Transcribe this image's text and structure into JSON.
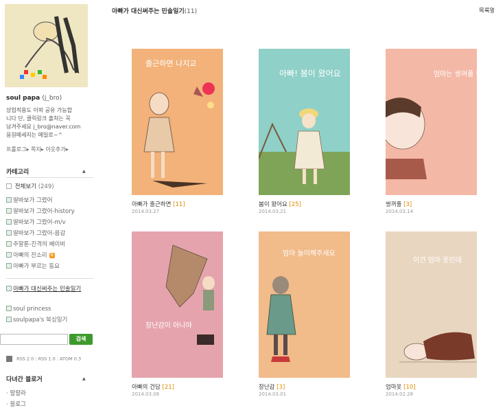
{
  "profile": {
    "nick": "soul papa",
    "id": "(j_bro)",
    "intro": [
      "상업적용도 이외 공유 가능합",
      "니다 단, 클릭링크 출처는 꼭",
      "남겨주세요 j_bro@naver.com",
      "응원메세지는 메일로~^"
    ],
    "links": [
      "프롤로그",
      "쪽지",
      "이웃추가"
    ]
  },
  "category": {
    "title": "카테고리",
    "all_label": "전체보기",
    "all_count": "(249)",
    "items": [
      "딸바보가 그렸어",
      "딸바보가 그렸어-history",
      "딸바보가 그렸어-m/v",
      "딸바보가 그렸어-음감",
      "주말툰-진격의 베이비",
      "아빠의 잔소리",
      "아빠가 부르는 동요"
    ],
    "new_badge": "N",
    "items2": [
      "아빠가 대신써주는 민솔일기",
      "soul princess",
      "soulpapa's 북싱일기"
    ]
  },
  "search": {
    "button": "검색",
    "placeholder": ""
  },
  "feeds": {
    "rss2": "RSS 2.0",
    "rss1": "RSS 1.0",
    "atom": "ATOM 0.3"
  },
  "neighbors": {
    "title": "다녀간 블로거",
    "items": [
      "랄랄라",
      "블로그"
    ]
  },
  "main": {
    "title": "아빠가 대신써주는 민솔일기",
    "count": "(11)",
    "list_link": "목록열기"
  },
  "cards": [
    {
      "title": "아빠가 출근하면",
      "comments": "[11]",
      "date": "2014.03.27",
      "art": "출근하면 나지교",
      "bg": "#f2b27a"
    },
    {
      "title": "봄이 왔어요",
      "comments": "[25]",
      "date": "2014.03.21",
      "art": "아빠! 봄이 왔어요",
      "bg": "#8fd0c8"
    },
    {
      "title": "쌍꺼풀",
      "comments": "[3]",
      "date": "2014.03.14",
      "art": "엄마는 쌍꺼풀 하지마",
      "bg": "#f4b8a6"
    },
    {
      "title": "아빠의 건담",
      "comments": "[21]",
      "date": "2014.03.08",
      "art": "장난감이 아니야",
      "bg": "#e5a4ad"
    },
    {
      "title": "장난감",
      "comments": "[3]",
      "date": "2014.03.01",
      "art": "엄마 놀이해주세요",
      "bg": "#f1bb8a"
    },
    {
      "title": "엄마옷",
      "comments": "[10]",
      "date": "2014.02.28",
      "art": "이건 엄마 옷인데",
      "bg": "#e8d6c0"
    }
  ],
  "colors": {
    "accent": "#3d9a2c",
    "comment": "#e08a00"
  }
}
